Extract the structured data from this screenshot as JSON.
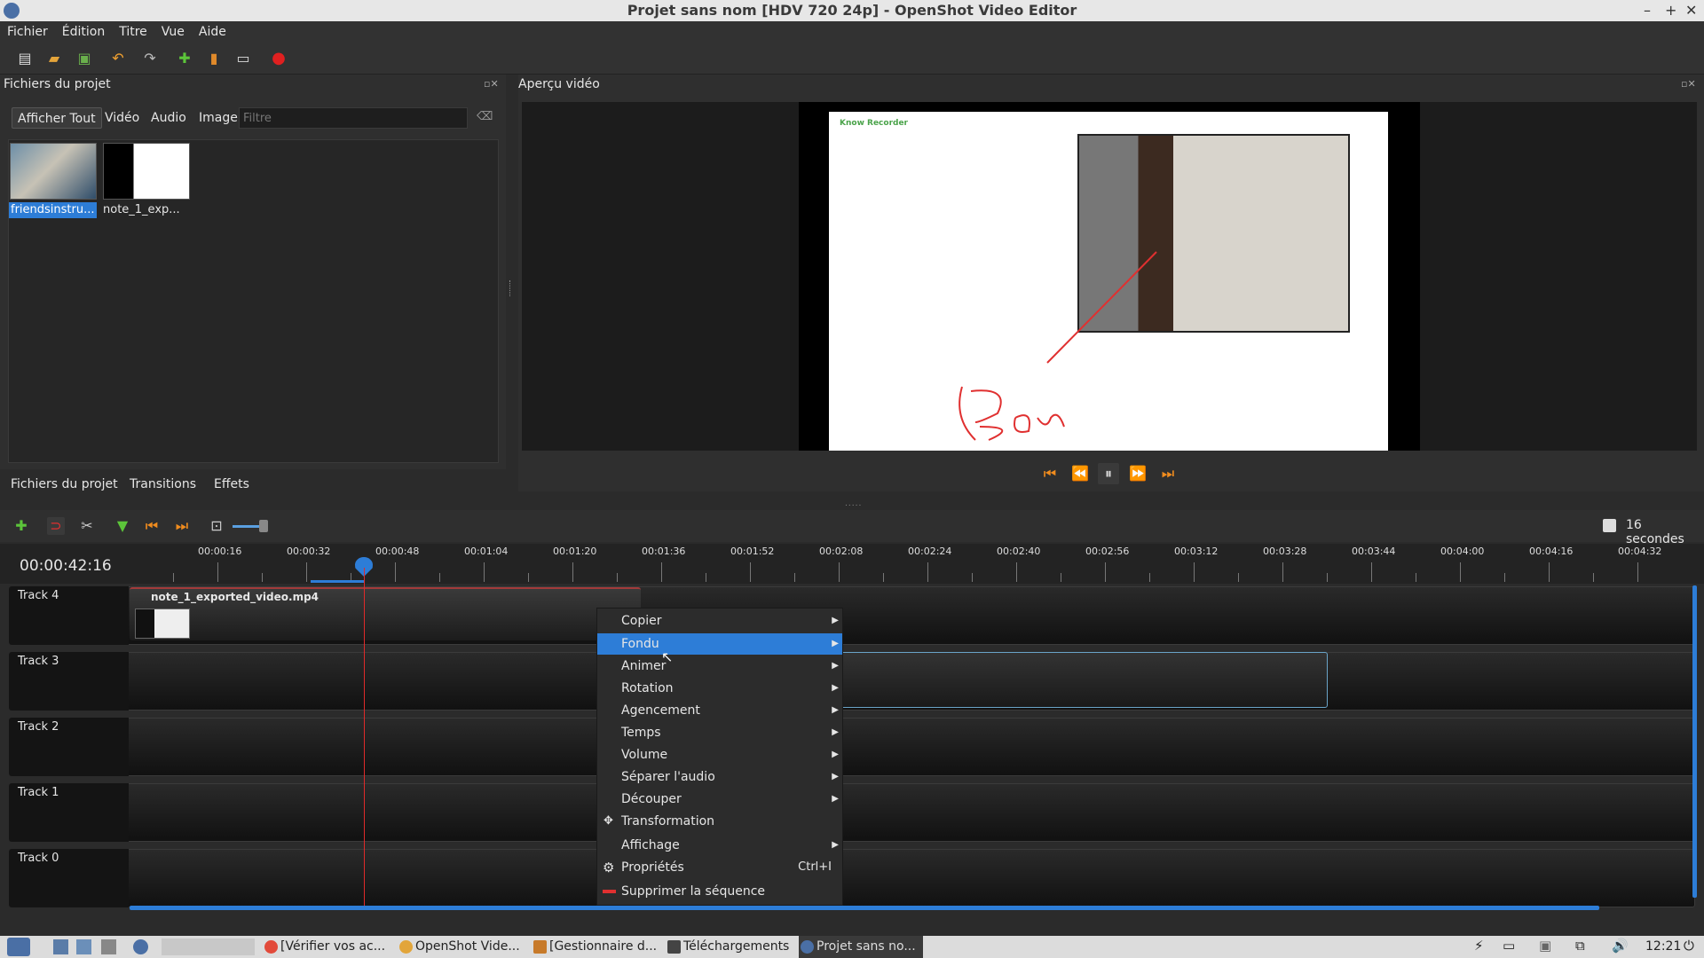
{
  "window": {
    "title": "Projet sans nom [HDV 720 24p] - OpenShot Video Editor",
    "controls": [
      "–",
      "+",
      "✕"
    ]
  },
  "menu": {
    "items": [
      "Fichier",
      "Édition",
      "Titre",
      "Vue",
      "Aide"
    ]
  },
  "project_panel": {
    "title": "Fichiers du projet",
    "filter_buttons": [
      "Afficher Tout",
      "Vidéo",
      "Audio",
      "Image"
    ],
    "filter_placeholder": "Filtre",
    "files": [
      {
        "name": "friendsinstru..."
      },
      {
        "name": "note_1_exp..."
      }
    ]
  },
  "bottom_tabs": [
    "Fichiers du projet",
    "Transitions",
    "Effets"
  ],
  "preview_panel": {
    "title": "Aperçu vidéo",
    "overlay_text": "Know Recorder"
  },
  "timeline": {
    "timecode": "00:00:42:16",
    "zoom_label": "16 secondes",
    "ruler": [
      "00:00:16",
      "00:00:32",
      "00:00:48",
      "00:01:04",
      "00:01:20",
      "00:01:36",
      "00:01:52",
      "00:02:08",
      "00:02:24",
      "00:02:40",
      "00:02:56",
      "00:03:12",
      "00:03:28",
      "00:03:44",
      "00:04:00",
      "00:04:16",
      "00:04:32"
    ],
    "tracks": [
      "Track 4",
      "Track 3",
      "Track 2",
      "Track 1",
      "Track 0"
    ],
    "clip_name": "note_1_exported_video.mp4"
  },
  "context_menu": {
    "items": [
      {
        "label": "Copier",
        "sub": true
      },
      {
        "label": "Fondu",
        "sub": true,
        "highlight": true
      },
      {
        "label": "Animer",
        "sub": true
      },
      {
        "label": "Rotation",
        "sub": true
      },
      {
        "label": "Agencement",
        "sub": true
      },
      {
        "label": "Temps",
        "sub": true
      },
      {
        "label": "Volume",
        "sub": true
      },
      {
        "label": "Séparer l'audio",
        "sub": true
      },
      {
        "label": "Découper",
        "sub": true
      },
      {
        "label": "Transformation",
        "sub": false
      },
      {
        "label": "Affichage",
        "sub": true
      },
      {
        "label": "Propriétés",
        "sub": false,
        "shortcut": "Ctrl+I"
      },
      {
        "label": "Supprimer la séquence",
        "sub": false
      }
    ]
  },
  "taskbar": {
    "tasks": [
      "[Vérifier vos ac...",
      "OpenShot Vide...",
      "[Gestionnaire d...",
      "Téléchargements",
      "Projet sans no..."
    ],
    "clock": "12:21"
  },
  "colors": {
    "accent": "#2d7dd7",
    "playhead": "#e02a2a",
    "transport": "#f08c1e"
  }
}
